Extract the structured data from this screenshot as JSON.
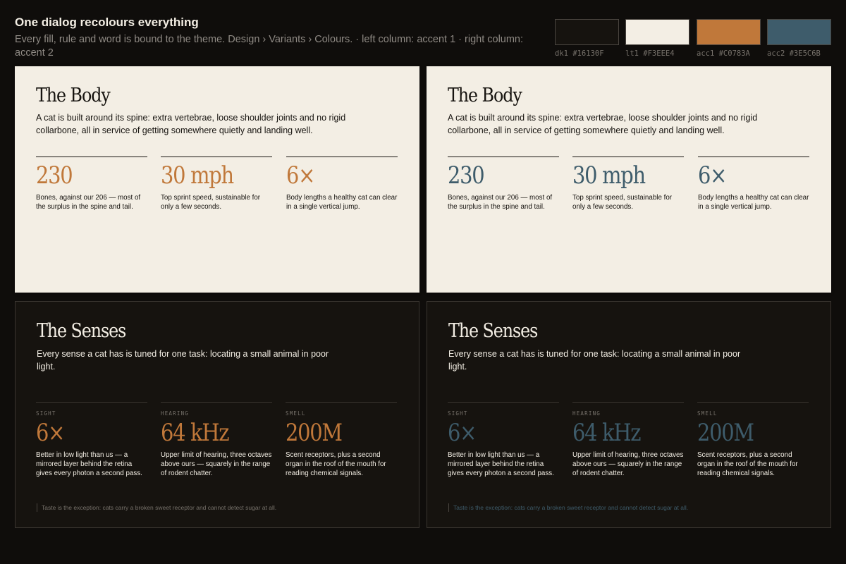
{
  "header": {
    "title": "One dialog recolours everything",
    "subtitle": "Every fill, rule and word is bound to the theme. Design › Variants › Colours.  ·  left column: accent 1  ·  right column: accent 2"
  },
  "swatches": [
    {
      "label": "dk1 #16130F",
      "color": "#16130F"
    },
    {
      "label": "lt1 #F3EEE4",
      "color": "#F3EEE4"
    },
    {
      "label": "acc1 #C0783A",
      "color": "#C0783A"
    },
    {
      "label": "acc2 #3E5C6B",
      "color": "#3E5C6B"
    }
  ],
  "body_slide": {
    "title": "The Body",
    "intro": "A cat is built around its spine: extra vertebrae, loose shoulder joints and no rigid collarbone, all in service of getting somewhere quietly and landing well.",
    "stats": [
      {
        "value": "230",
        "desc": "Bones, against our 206 — most of the surplus in the spine and tail."
      },
      {
        "value": "30 mph",
        "desc": "Top sprint speed, sustainable for only a few seconds."
      },
      {
        "value": "6×",
        "desc": "Body lengths a healthy cat can clear in a single vertical jump."
      }
    ]
  },
  "senses_slide": {
    "title": "The Senses",
    "intro": "Every sense a cat has is tuned for one task: locating a small animal in poor light.",
    "stats": [
      {
        "kicker": "SIGHT",
        "value": "6×",
        "desc": "Better in low light than us — a mirrored layer behind the retina gives every photon a second pass."
      },
      {
        "kicker": "HEARING",
        "value": "64 kHz",
        "desc": "Upper limit of hearing, three octaves above ours — squarely in the range of rodent chatter."
      },
      {
        "kicker": "SMELL",
        "value": "200M",
        "desc": "Scent receptors, plus a second organ in the roof of the mouth for reading chemical signals."
      }
    ],
    "footnote": "Taste is the exception: cats carry a broken sweet receptor and cannot detect sugar at all."
  }
}
